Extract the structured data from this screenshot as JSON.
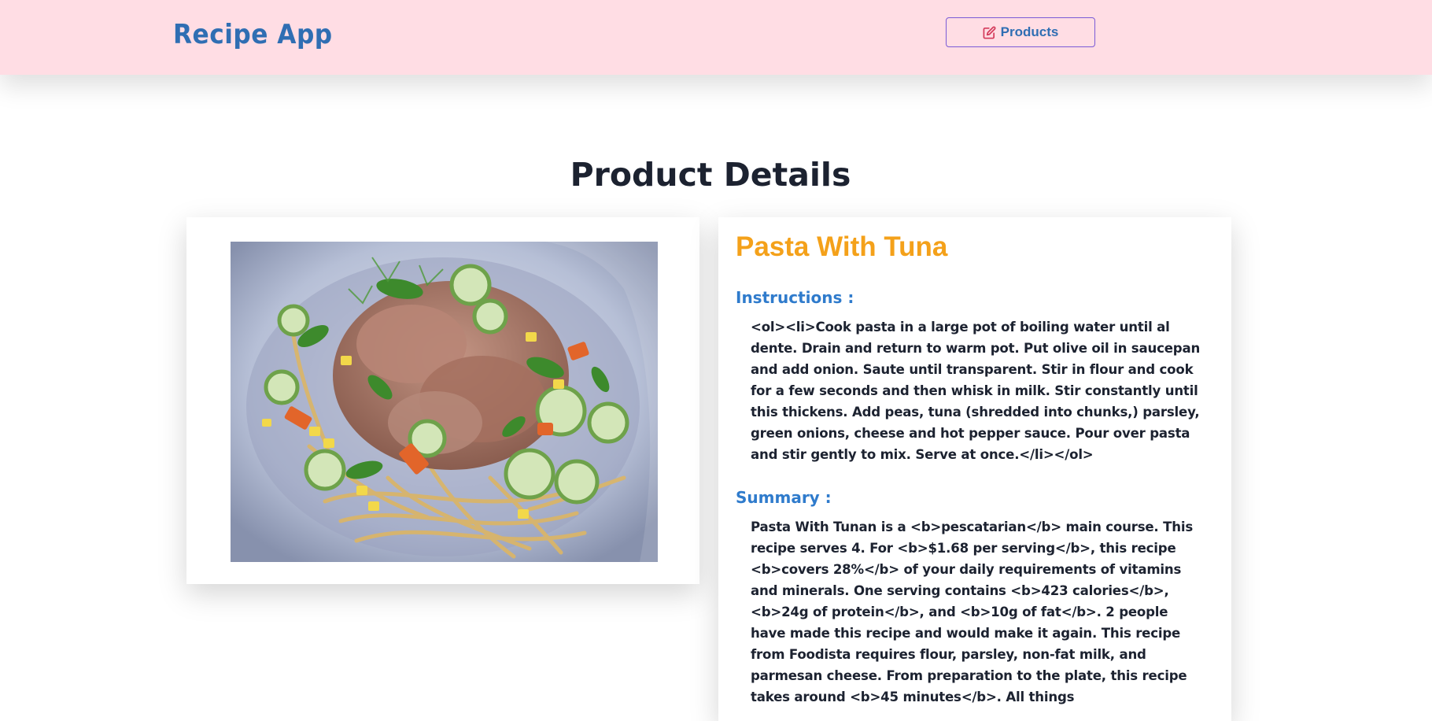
{
  "navbar": {
    "brand": "Recipe App",
    "products_label": "Products",
    "products_icon": "edit-icon",
    "accent_color": "#2f6eb3",
    "background_color": "#ffdde4"
  },
  "main": {
    "page_title": "Product Details",
    "product": {
      "title": "Pasta With Tuna",
      "title_color": "#f4a11a",
      "image_alt": "Pasta With Tuna",
      "instructions_heading": "Instructions :",
      "instructions_text": "<ol><li>Cook pasta in a large pot of boiling water until al dente. Drain and return to warm pot. Put olive oil in saucepan and add onion. Saute until transparent. Stir in flour and cook for a few seconds and then whisk in milk. Stir constantly until this thickens. Add peas, tuna (shredded into chunks,) parsley, green onions, cheese and hot pepper sauce. Pour over pasta and stir gently to mix. Serve at once.</li></ol>",
      "summary_heading": "Summary :",
      "summary_text": "Pasta With Tunan is a <b>pescatarian</b> main course. This recipe serves 4. For <b>$1.68 per serving</b>, this recipe <b>covers 28%</b> of your daily requirements of vitamins and minerals. One serving contains <b>423 calories</b>, <b>24g of protein</b>, and <b>10g of fat</b>. 2 people have made this recipe and would make it again. This recipe from Foodista requires flour, parsley, non-fat milk, and parmesan cheese. From preparation to the plate, this recipe takes around <b>45 minutes</b>. All things"
    }
  }
}
